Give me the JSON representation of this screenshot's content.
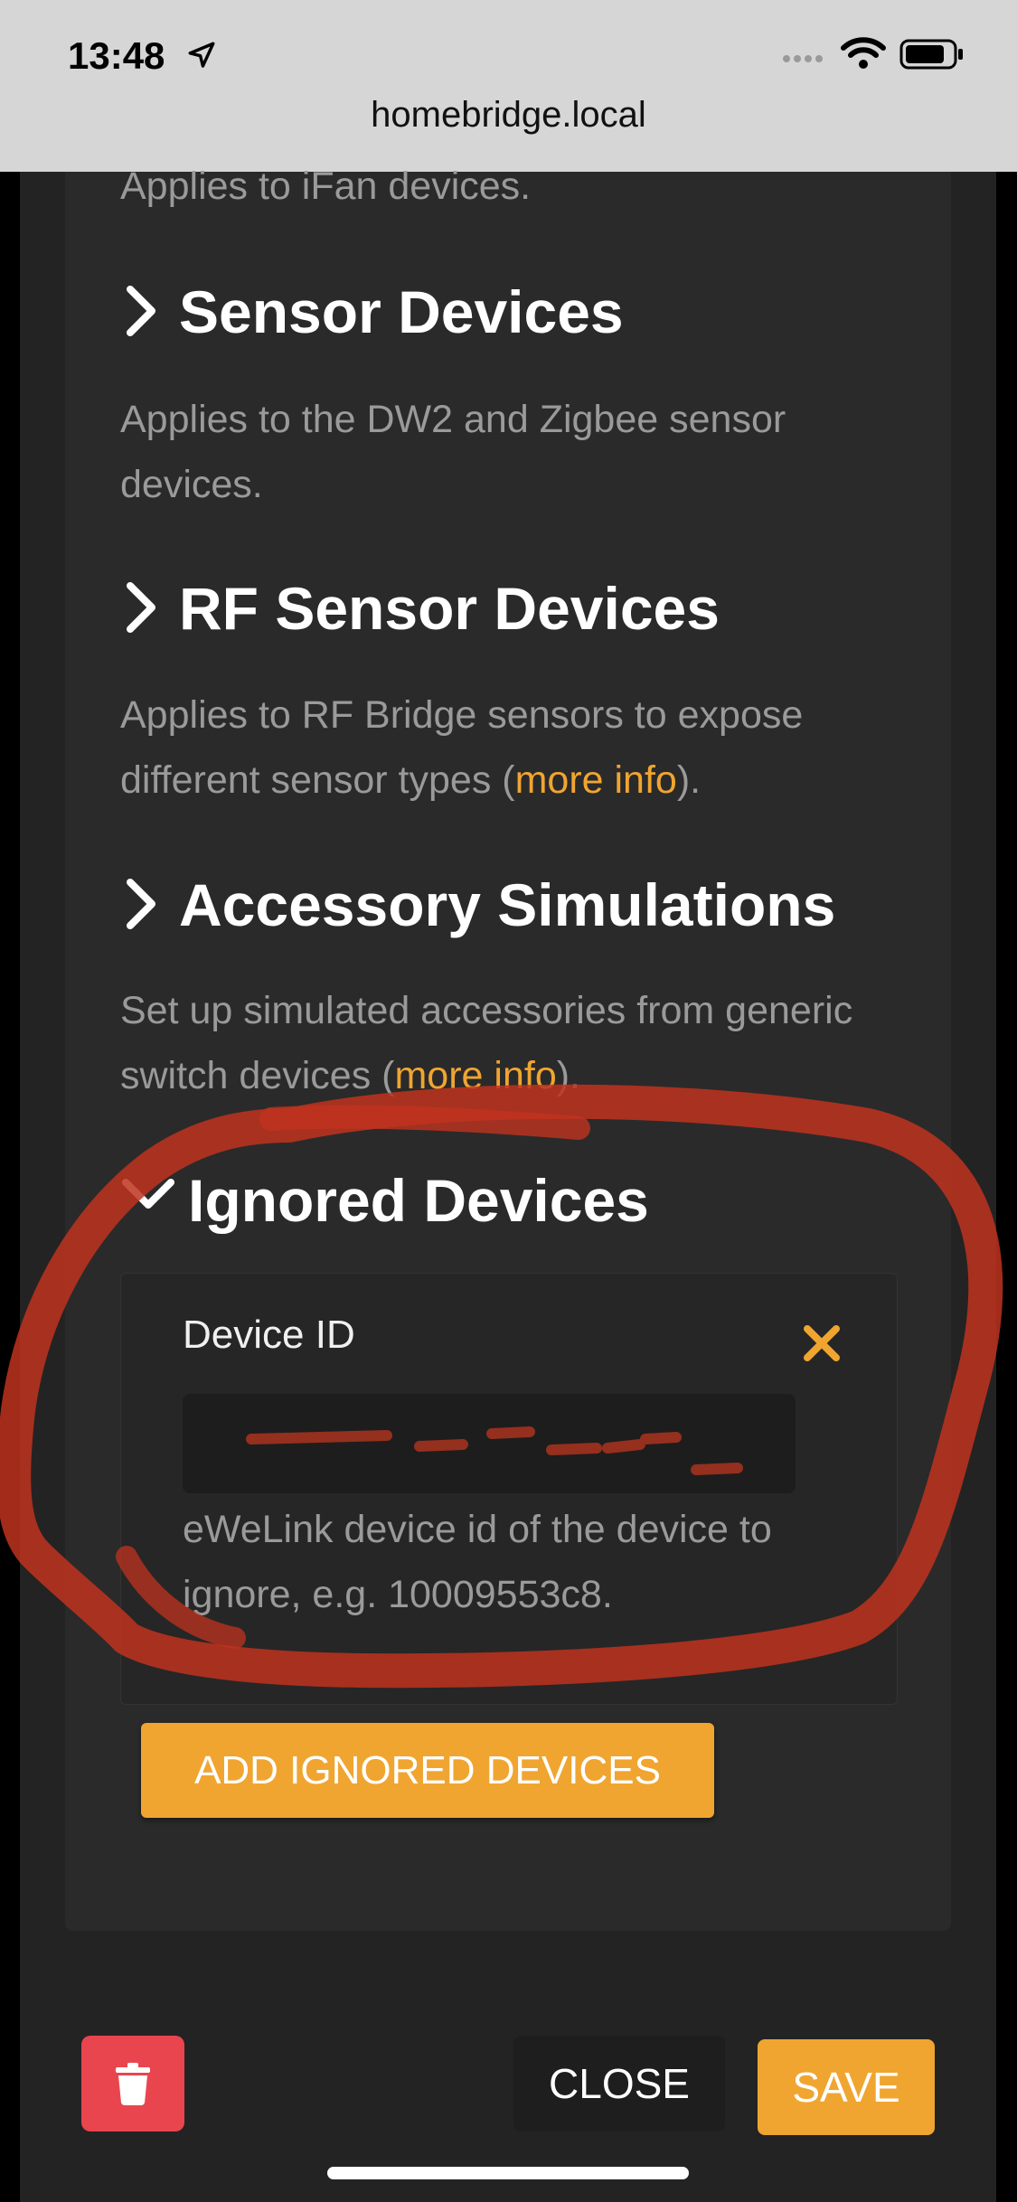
{
  "status_bar": {
    "time": "13:48",
    "url": "homebridge.local"
  },
  "sections": [
    {
      "title": "",
      "description": "Applies to iFan devices."
    },
    {
      "title": "Sensor Devices",
      "description": "Applies to the DW2 and Zigbee sensor devices."
    },
    {
      "title": "RF Sensor Devices",
      "description_prefix": "Applies to RF Bridge sensors to expose different sensor types (",
      "link": "more info",
      "description_suffix": ")."
    },
    {
      "title": "Accessory Simulations",
      "description_prefix": "Set up simulated accessories from generic switch devices (",
      "link": "more info",
      "description_suffix": ")."
    },
    {
      "title": "Ignored Devices"
    }
  ],
  "ignored_device": {
    "label": "Device ID",
    "help": "eWeLink device id of the device to ignore, e.g. 10009553c8."
  },
  "buttons": {
    "add": "ADD IGNORED DEVICES",
    "close": "CLOSE",
    "save": "SAVE"
  },
  "colors": {
    "accent": "#f0a531",
    "danger": "#e9454f",
    "annotation": "#c0331f"
  }
}
